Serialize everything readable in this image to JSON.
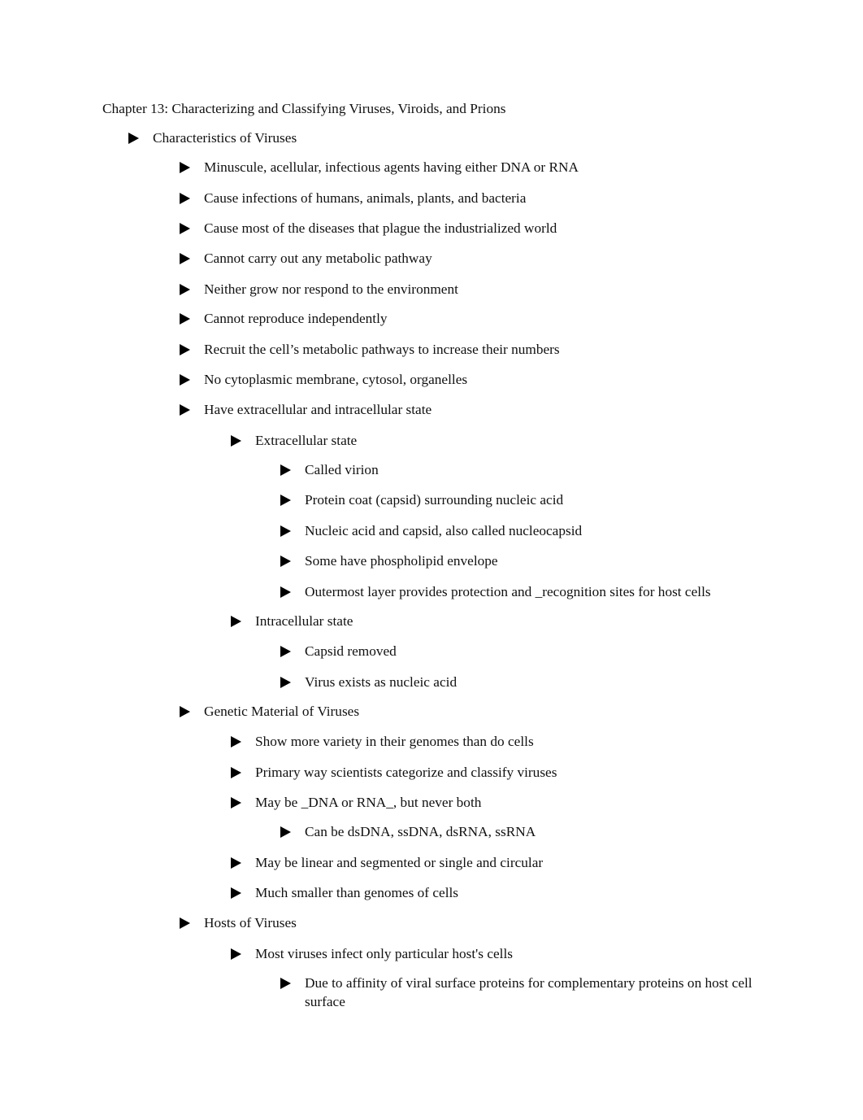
{
  "document": {
    "title": "Chapter 13: Characterizing and Classifying Viruses, Viroids, and Prions",
    "bullet_icon": "right-pointing-triangle",
    "items": [
      {
        "level": 1,
        "text": "Characteristics of Viruses"
      },
      {
        "level": 2,
        "text": "Minuscule, acellular, infectious agents having either DNA or RNA"
      },
      {
        "level": 2,
        "text": "Cause infections of humans, animals, plants, and bacteria"
      },
      {
        "level": 2,
        "text": "Cause most of the diseases that plague the industrialized world"
      },
      {
        "level": 2,
        "text": "Cannot carry out any metabolic pathway"
      },
      {
        "level": 2,
        "text": "Neither grow nor respond to the environment"
      },
      {
        "level": 2,
        "text": "Cannot reproduce independently"
      },
      {
        "level": 2,
        "text": "Recruit the cell’s metabolic pathways to increase their numbers"
      },
      {
        "level": 2,
        "text": "No cytoplasmic membrane, cytosol, organelles"
      },
      {
        "level": 2,
        "text": "Have extracellular and intracellular state"
      },
      {
        "level": 3,
        "text": "Extracellular state"
      },
      {
        "level": 4,
        "text": "Called virion"
      },
      {
        "level": 4,
        "text": "Protein coat (capsid) surrounding nucleic acid"
      },
      {
        "level": 4,
        "text": "Nucleic acid and capsid, also called nucleocapsid"
      },
      {
        "level": 4,
        "text": "Some have phospholipid envelope"
      },
      {
        "level": 4,
        "text": "Outermost layer provides protection and _recognition sites for host cells"
      },
      {
        "level": 3,
        "text": "Intracellular state"
      },
      {
        "level": 4,
        "text": "Capsid removed"
      },
      {
        "level": 4,
        "text": "Virus exists as nucleic acid"
      },
      {
        "level": 2,
        "text": "Genetic Material of Viruses"
      },
      {
        "level": 3,
        "text": "Show more variety in their genomes than do cells"
      },
      {
        "level": 3,
        "text": "Primary way scientists categorize and classify viruses"
      },
      {
        "level": 3,
        "text": "May be _DNA or RNA_, but never both"
      },
      {
        "level": 4,
        "text": "Can be dsDNA, ssDNA, dsRNA, ssRNA"
      },
      {
        "level": 3,
        "text": "May be linear and segmented or single and circular"
      },
      {
        "level": 3,
        "text": "Much smaller than genomes of cells"
      },
      {
        "level": 2,
        "text": "Hosts of Viruses"
      },
      {
        "level": 3,
        "text": "Most viruses infect only particular host's cells"
      },
      {
        "level": 4,
        "text": "Due to affinity of viral surface proteins for complementary proteins on host cell surface"
      }
    ]
  }
}
